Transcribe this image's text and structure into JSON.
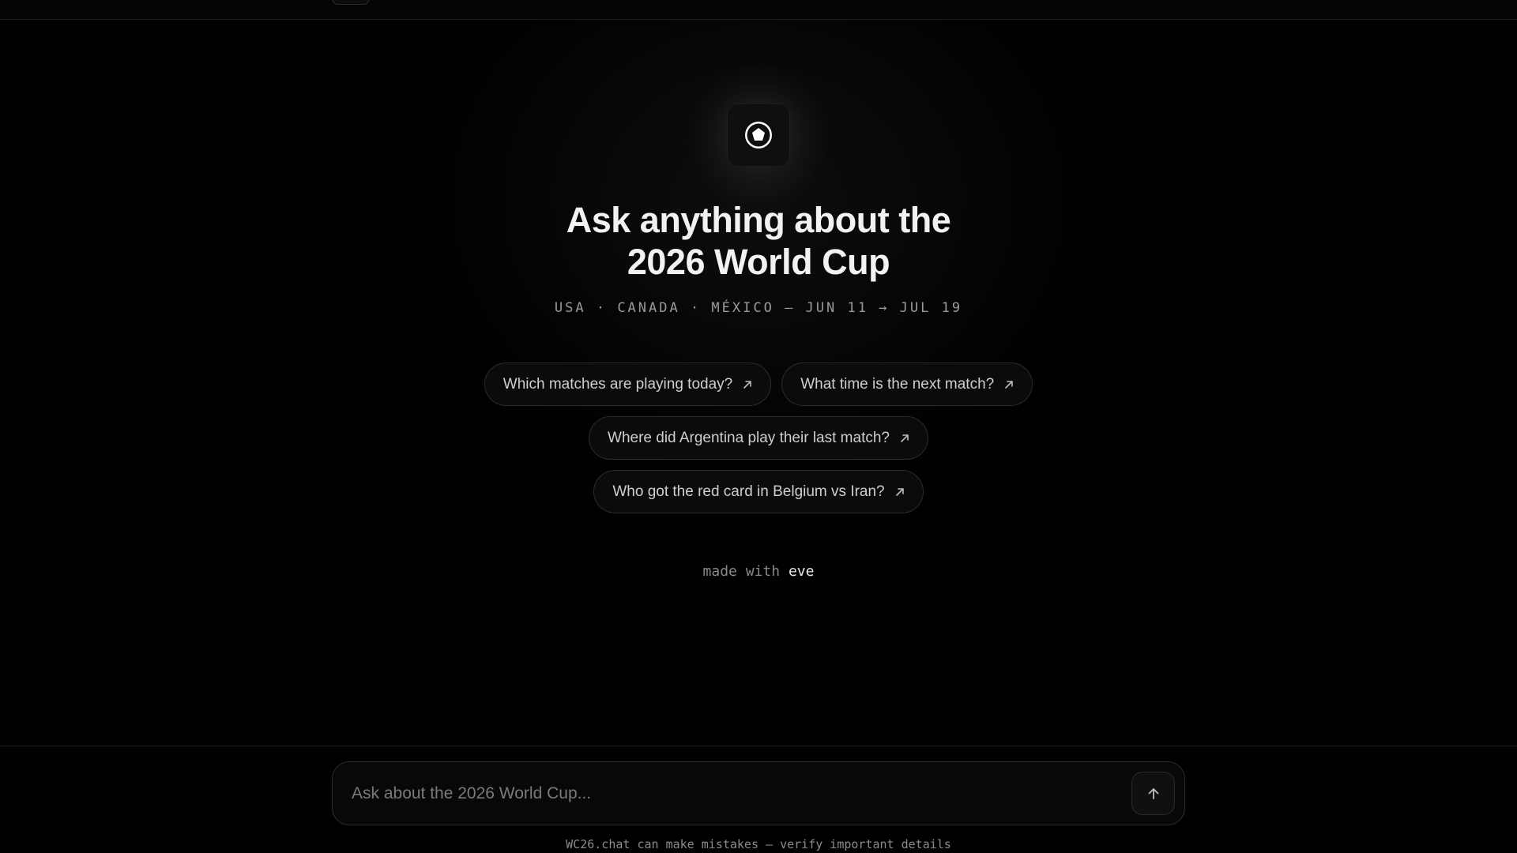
{
  "hero": {
    "logo_icon": "soccer-ball-icon",
    "title_line1": "Ask anything about the",
    "title_line2": "2026 World Cup",
    "subtitle": "USA · CANADA · MÉXICO — JUN 11 → JUL 19"
  },
  "suggestions": [
    {
      "label": "Which matches are playing today?",
      "icon": "arrow-up-right-icon"
    },
    {
      "label": "What time is the next match?",
      "icon": "arrow-up-right-icon"
    },
    {
      "label": "Where did Argentina play their last match?",
      "icon": "arrow-up-right-icon"
    },
    {
      "label": "Who got the red card in Belgium vs Iran?",
      "icon": "arrow-up-right-icon"
    }
  ],
  "footer": {
    "made_with_prefix": "made with",
    "made_with_brand": "eve"
  },
  "composer": {
    "placeholder": "Ask about the 2026 World Cup...",
    "value": "",
    "send_icon": "arrow-up-icon"
  },
  "disclaimer": "WC26.chat can make mistakes — verify important details",
  "colors": {
    "background": "#000000",
    "text_primary": "#f2f2f2",
    "text_muted": "#9a9a9a",
    "border": "#2c2c2c"
  }
}
